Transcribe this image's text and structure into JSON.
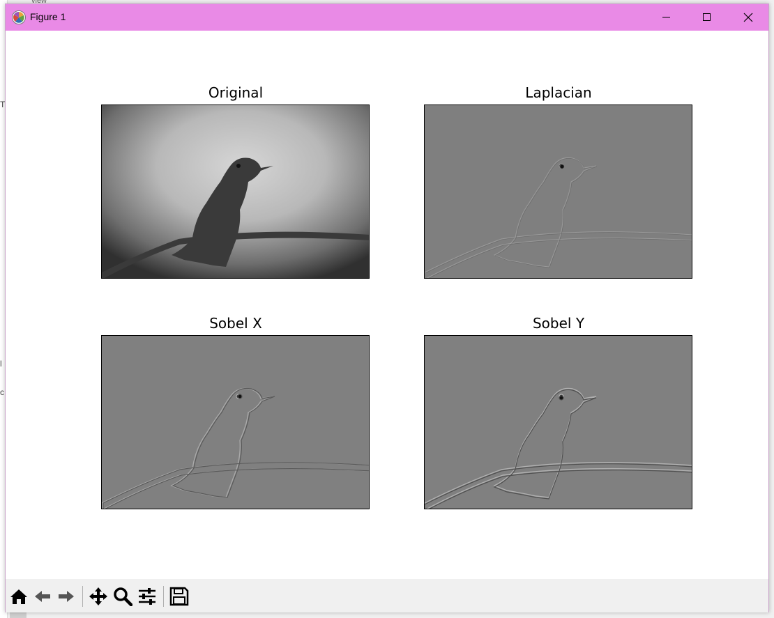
{
  "window": {
    "title": "Figure 1"
  },
  "background_app": {
    "top_text": "view",
    "side_letters": [
      "T",
      "l",
      "c"
    ]
  },
  "figure": {
    "subplots": [
      {
        "title": "Original"
      },
      {
        "title": "Laplacian"
      },
      {
        "title": "Sobel X"
      },
      {
        "title": "Sobel Y"
      }
    ]
  },
  "toolbar": {
    "tools": [
      "home-icon",
      "back-icon",
      "forward-icon",
      "pan-icon",
      "zoom-icon",
      "configure-subplots-icon",
      "save-icon"
    ]
  },
  "colors": {
    "titlebar": "#e98ae6",
    "laplacian_bg": "#7f7f7f",
    "sobel_bg": "#808080"
  }
}
